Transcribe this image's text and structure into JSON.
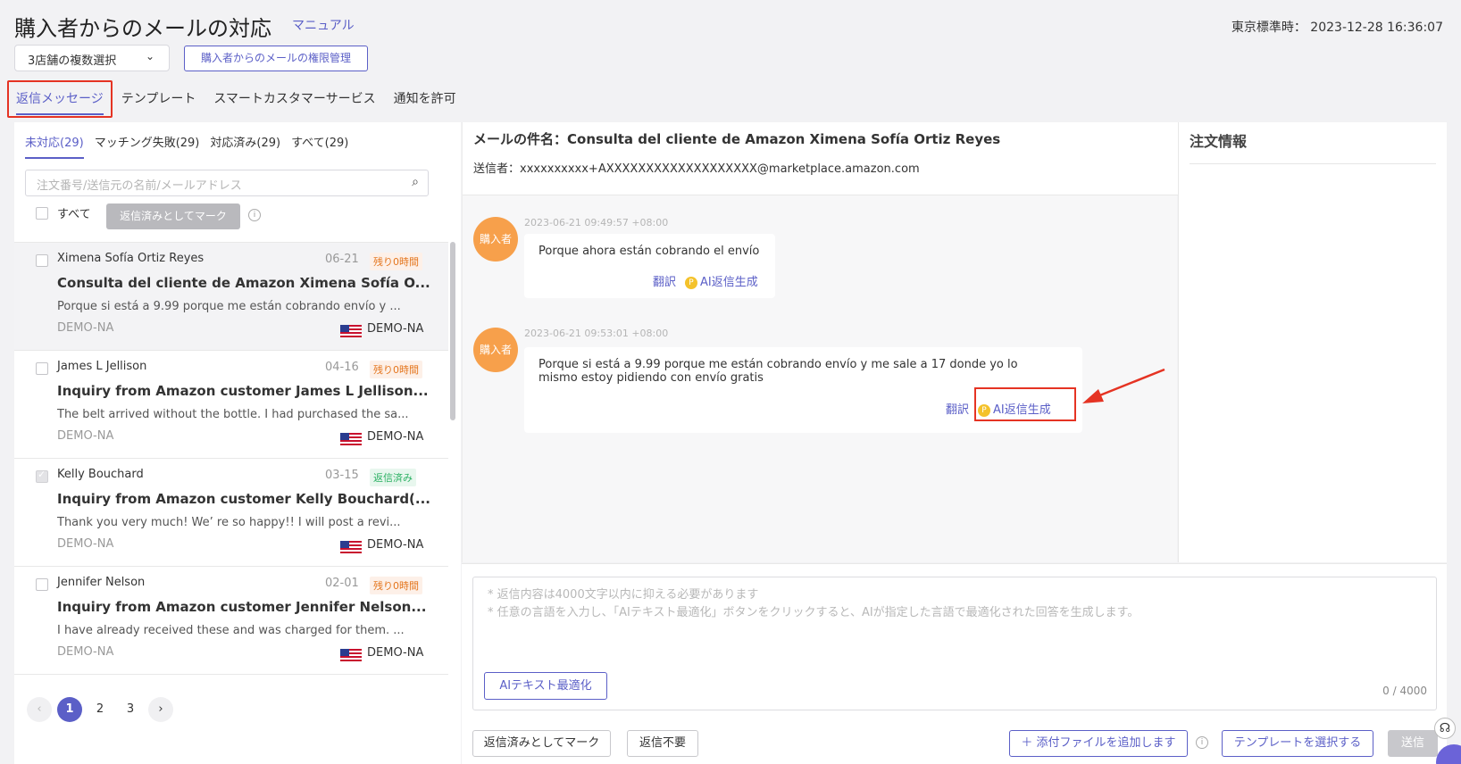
{
  "header": {
    "title": "購入者からのメールの対応",
    "manual_link": "マニュアル",
    "clock": "東京標準時： 2023-12-28 16:36:07",
    "store_select": "3店舗の複数選択",
    "permission_button": "購入者からのメールの権限管理"
  },
  "tabs": [
    "返信メッセージ",
    "テンプレート",
    "スマートカスタマーサービス",
    "通知を許可"
  ],
  "list": {
    "filter_tabs": [
      "未対応(29)",
      "マッチング失敗(29)",
      "対応済み(29)",
      "すべて(29)"
    ],
    "search_placeholder": "注文番号/送信元の名前/メールアドレス",
    "select_all": "すべて",
    "mark_replied": "返信済みとしてマーク",
    "items": [
      {
        "name": "Ximena Sofía Ortiz Reyes",
        "date": "06-21",
        "badge": "残り0時間",
        "subject": "Consulta del cliente de Amazon Ximena Sofía O...",
        "preview": "Porque si está a 9.99 porque me están cobrando envío y ...",
        "store": "DEMO-NA",
        "store_right": "DEMO-NA"
      },
      {
        "name": "James L Jellison",
        "date": "04-16",
        "badge": "残り0時間",
        "subject": "Inquiry from Amazon customer James L Jellison...",
        "preview": "The belt arrived without the bottle. I had purchased the sa...",
        "store": "DEMO-NA",
        "store_right": "DEMO-NA"
      },
      {
        "name": "Kelly Bouchard",
        "date": "03-15",
        "badge": "返信済み",
        "subject": "Inquiry from Amazon customer Kelly Bouchard(...",
        "preview": "Thank you very much! We’ re so happy!! I will post a revi...",
        "store": "DEMO-NA",
        "store_right": "DEMO-NA"
      },
      {
        "name": "Jennifer Nelson",
        "date": "02-01",
        "badge": "残り0時間",
        "subject": "Inquiry from Amazon customer Jennifer Nelson...",
        "preview": "I have already received these and was charged for them. ...",
        "store": "DEMO-NA",
        "store_right": "DEMO-NA"
      }
    ],
    "pages": [
      "1",
      "2",
      "3"
    ]
  },
  "message": {
    "subject": "メールの件名：Consulta del cliente de Amazon Ximena Sofía Ortiz Reyes",
    "sender": "送信者：xxxxxxxxxx+AXXXXXXXXXXXXXXXXXXX@marketplace.amazon.com",
    "avatar_label": "購入者",
    "translate": "翻訳",
    "ai_reply": "AI返信生成",
    "messages": [
      {
        "time": "2023-06-21 09:49:57 +08:00",
        "text": "Porque ahora están cobrando el envío"
      },
      {
        "time": "2023-06-21 09:53:01 +08:00",
        "text_line1": "Porque si está a 9.99 porque me están cobrando envío y me sale a 17 donde yo lo",
        "text_line2": "mismo estoy pidiendo con envío gratis"
      }
    ]
  },
  "order_info": {
    "title": "注文情報"
  },
  "reply": {
    "placeholder1": "* 返信内容は4000文字以内に抑える必要があります",
    "placeholder2": "* 任意の言語を入力し、「AIテキスト最適化」ボタンをクリックすると、AIが指定した言語で最適化された回答を生成します。",
    "ai_optimize": "AIテキスト最適化",
    "counter": "0 / 4000",
    "mark_replied": "返信済みとしてマーク",
    "no_reply": "返信不要",
    "add_attachment": "＋ 添付ファイルを追加します",
    "select_template": "テンプレートを選択する",
    "send": "送信"
  },
  "colors": {
    "accent": "#5b5fc7",
    "highlight": "#e53323",
    "avatar": "#f7a04b"
  }
}
